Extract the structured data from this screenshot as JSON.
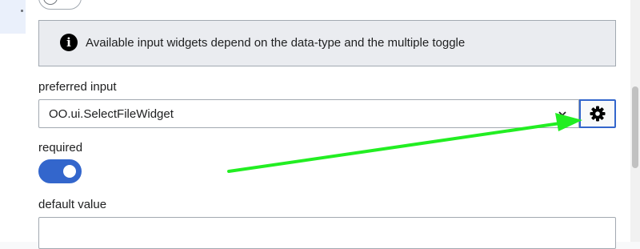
{
  "notice": {
    "icon": "info-icon",
    "text": "Available input widgets depend on the data-type and the multiple toggle"
  },
  "fields": {
    "preferred_input": {
      "label": "preferred input",
      "value": "OO.ui.SelectFileWidget",
      "settings_icon": "gear-icon"
    },
    "required": {
      "label": "required",
      "enabled": true
    },
    "default_value": {
      "label": "default value",
      "value": ""
    }
  },
  "annotation": {
    "type": "arrow",
    "color": "#22ee22",
    "points_to": "gear-button"
  },
  "colors": {
    "accent": "#3366cc",
    "notice_background": "#eaecf0",
    "border": "#a2a9b1"
  }
}
